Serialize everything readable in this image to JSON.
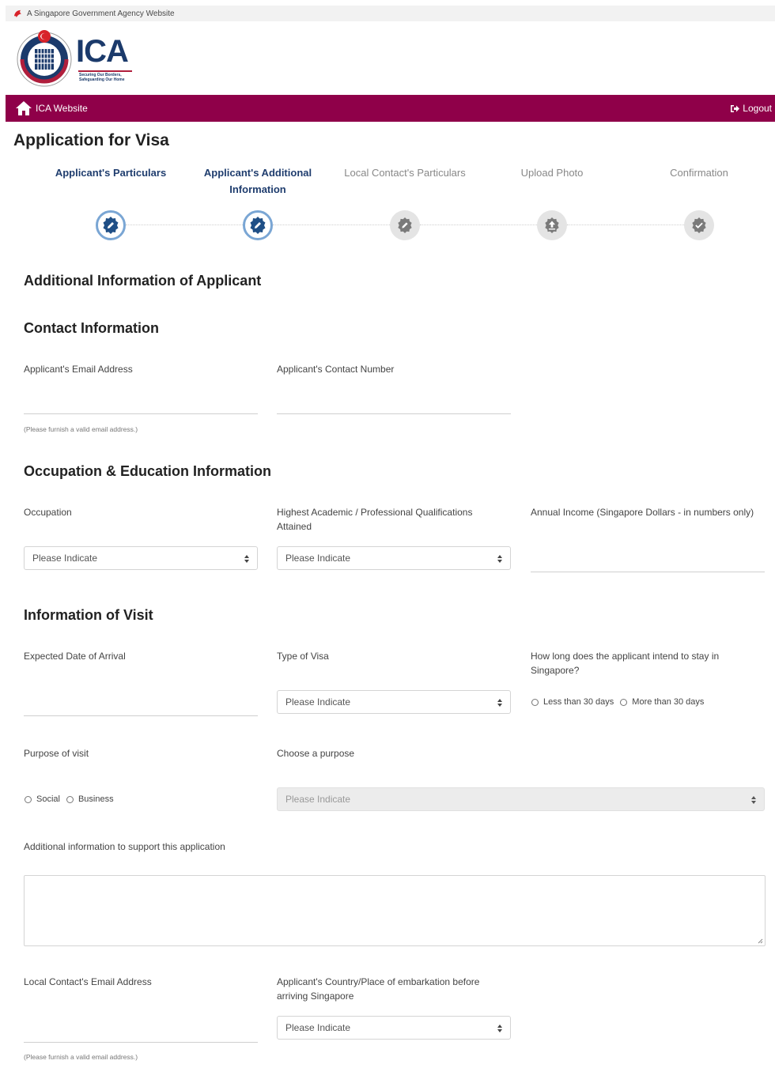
{
  "gov_banner": {
    "text": "A Singapore Government Agency Website"
  },
  "logo": {
    "text": "ICA",
    "tagline_1": "Securing Our Borders,",
    "tagline_2": "Safeguarding Our Home"
  },
  "navbar": {
    "home_label": "ICA Website",
    "logout_label": "Logout",
    "color": "#8f0049"
  },
  "page": {
    "title": "Application for Visa"
  },
  "steps": [
    {
      "label": "Applicant's Particulars",
      "state": "active",
      "icon": "edit-badge-icon"
    },
    {
      "label": "Applicant's Additional Information",
      "state": "active",
      "icon": "edit-badge-icon"
    },
    {
      "label": "Local Contact's Particulars",
      "state": "inactive",
      "icon": "edit-badge-icon"
    },
    {
      "label": "Upload Photo",
      "state": "inactive",
      "icon": "upload-badge-icon"
    },
    {
      "label": "Confirmation",
      "state": "inactive",
      "icon": "check-badge-icon"
    }
  ],
  "sections": {
    "additional": "Additional Information of Applicant",
    "contact": "Contact Information",
    "occupation": "Occupation & Education Information",
    "visit": "Information of Visit"
  },
  "contact": {
    "email_label": "Applicant's Email Address",
    "email_value": "",
    "email_hint": "(Please furnish a valid email address.)",
    "phone_label": "Applicant's Contact Number",
    "phone_value": ""
  },
  "occupation": {
    "occupation_label": "Occupation",
    "occupation_value": "Please Indicate",
    "qualification_label": "Highest Academic / Professional Qualifications Attained",
    "qualification_value": "Please Indicate",
    "income_label": "Annual Income (Singapore Dollars - in numbers only)",
    "income_value": ""
  },
  "visit": {
    "arrival_label": "Expected Date of Arrival",
    "arrival_value": "",
    "visa_type_label": "Type of Visa",
    "visa_type_value": "Please Indicate",
    "stay_label": "How long does the applicant intend to stay in Singapore?",
    "stay_options": [
      "Less than 30 days",
      "More than 30 days"
    ],
    "purpose_label": "Purpose of visit",
    "purpose_options": [
      "Social",
      "Business"
    ],
    "choose_purpose_label": "Choose a purpose",
    "choose_purpose_value": "Please Indicate",
    "additional_info_label": "Additional information to support this application",
    "additional_info_value": "",
    "local_email_label": "Local Contact's Email Address",
    "local_email_value": "",
    "local_email_hint": "(Please furnish a valid email address.)",
    "embarkation_label": "Applicant's Country/Place of embarkation before arriving Singapore",
    "embarkation_value": "Please Indicate"
  }
}
